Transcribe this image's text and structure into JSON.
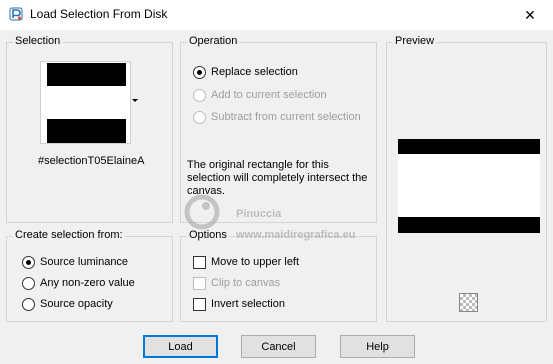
{
  "window": {
    "title": "Load Selection From Disk",
    "close_glyph": "✕"
  },
  "selection_panel": {
    "title": "Selection",
    "selection_name": "#selectionT05ElaineA"
  },
  "operation_panel": {
    "title": "Operation",
    "options": [
      {
        "label": "Replace selection",
        "checked": true,
        "enabled": true
      },
      {
        "label": "Add to current selection",
        "checked": false,
        "enabled": false
      },
      {
        "label": "Subtract from current selection",
        "checked": false,
        "enabled": false
      }
    ],
    "info": "The original rectangle for this selection will completely intersect the canvas."
  },
  "preview_panel": {
    "title": "Preview"
  },
  "create_panel": {
    "title": "Create selection from:",
    "options": [
      {
        "label": "Source luminance",
        "checked": true
      },
      {
        "label": "Any non-zero value",
        "checked": false
      },
      {
        "label": "Source opacity",
        "checked": false
      }
    ]
  },
  "options_panel": {
    "title": "Options",
    "checks": [
      {
        "label": "Move to upper left",
        "checked": false,
        "enabled": true
      },
      {
        "label": "Clip to canvas",
        "checked": false,
        "enabled": false
      },
      {
        "label": "Invert selection",
        "checked": false,
        "enabled": true
      }
    ]
  },
  "buttons": {
    "load": "Load",
    "cancel": "Cancel",
    "help": "Help"
  },
  "watermark": {
    "line1": "Pinuccia",
    "line2": "www.maidiregrafica.eu"
  },
  "icons": {
    "app": "paintshop-icon",
    "close": "close-icon",
    "dropdown": "chevron-down-icon",
    "checker": "transparency-checker-icon"
  },
  "colors": {
    "accent": "#0078d7",
    "panel_border": "#d5d5d5",
    "background": "#f0f0f0"
  }
}
